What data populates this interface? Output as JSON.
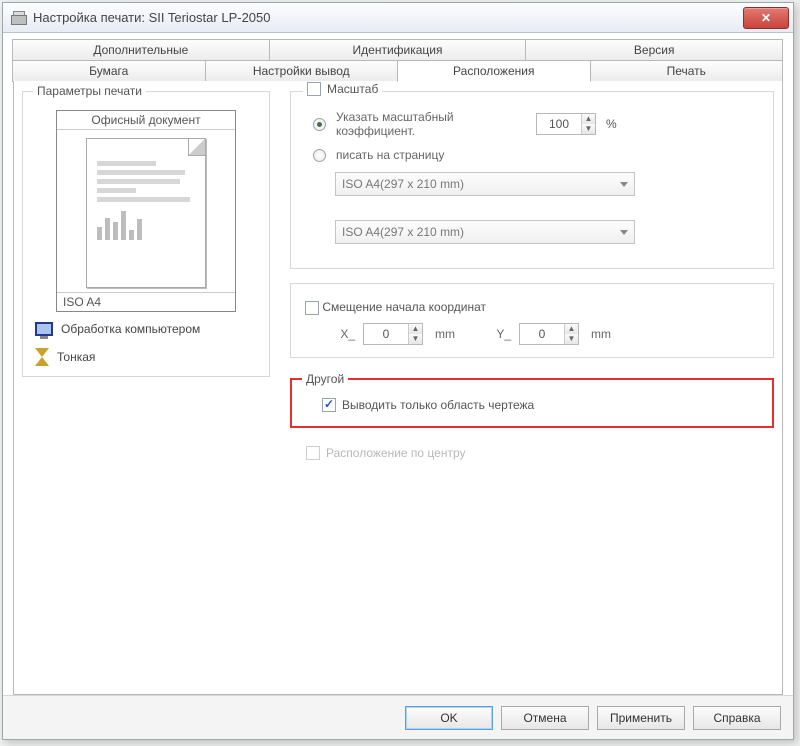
{
  "window": {
    "title": "Настройка печати: SII Teriostar LP-2050"
  },
  "tabs": {
    "row1": [
      "Дополнительные",
      "Идентификация",
      "Версия"
    ],
    "row2": [
      "Бумага",
      "Настройки вывод",
      "Расположения",
      "Печать"
    ],
    "active": "Расположения"
  },
  "left": {
    "group_title": "Параметры печати",
    "doc_type": "Офисный документ",
    "page_size": "ISO A4",
    "processing": "Обработка компьютером",
    "quality": "Тонкая"
  },
  "scale": {
    "group_label": "Масштаб",
    "opt_factor": "Указать масштабный коэффициент.",
    "factor_value": "100",
    "percent": "%",
    "opt_fit": "писать на страницу",
    "combo1": "ISO A4(297 x 210 mm)",
    "combo2": "ISO A4(297 x 210 mm)"
  },
  "offset": {
    "group_label": "Смещение начала координат",
    "x_label": "X_",
    "x_value": "0",
    "y_label": "Y_",
    "y_value": "0",
    "unit": "mm"
  },
  "other": {
    "group_title": "Другой",
    "checkbox_label": "Выводить только область чертежа"
  },
  "center": {
    "label": "Расположение по центру"
  },
  "buttons": {
    "ok": "OK",
    "cancel": "Отмена",
    "apply": "Применить",
    "help": "Справка"
  }
}
